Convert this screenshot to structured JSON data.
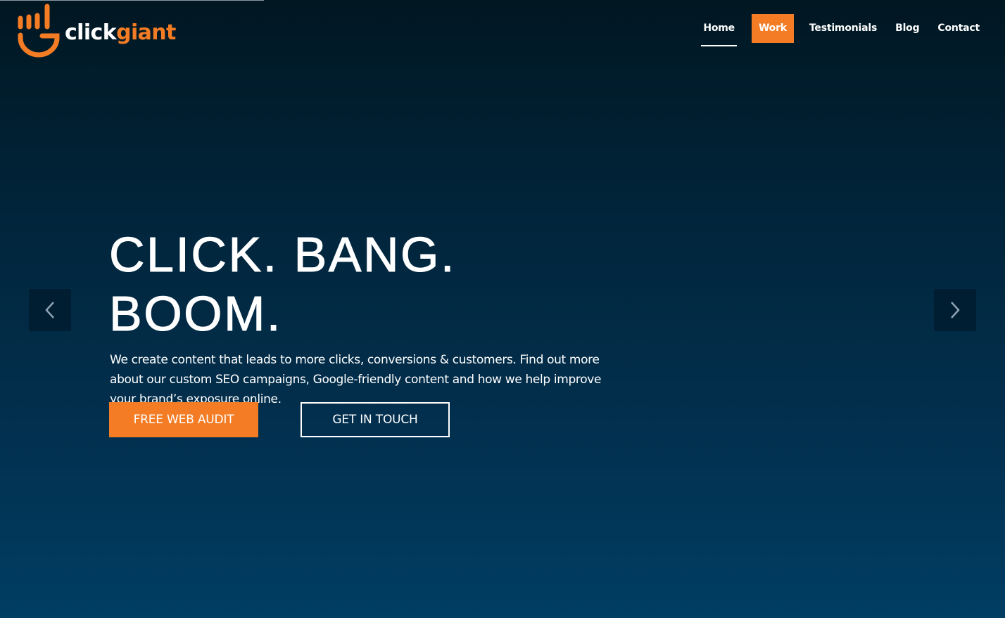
{
  "brand": {
    "name_part1": "click",
    "name_part2": "giant",
    "logo_icon": "hand-logo-icon",
    "accent_color": "#f37c24"
  },
  "nav": {
    "items": [
      {
        "label": "Home",
        "state": "active"
      },
      {
        "label": "Work",
        "state": "highlight"
      },
      {
        "label": "Testimonials",
        "state": "normal"
      },
      {
        "label": "Blog",
        "state": "normal"
      },
      {
        "label": "Contact",
        "state": "normal"
      }
    ]
  },
  "hero": {
    "title": "CLICK. BANG. BOOM.",
    "description": "We create content that leads to more clicks, conversions & customers. Find out more about our custom SEO campaigns, Google-friendly content and how we help improve your brand’s exposure online.",
    "buttons": {
      "primary": "FREE WEB AUDIT",
      "secondary": "GET IN TOUCH"
    }
  },
  "slider": {
    "prev_icon": "chevron-left-icon",
    "next_icon": "chevron-right-icon"
  }
}
